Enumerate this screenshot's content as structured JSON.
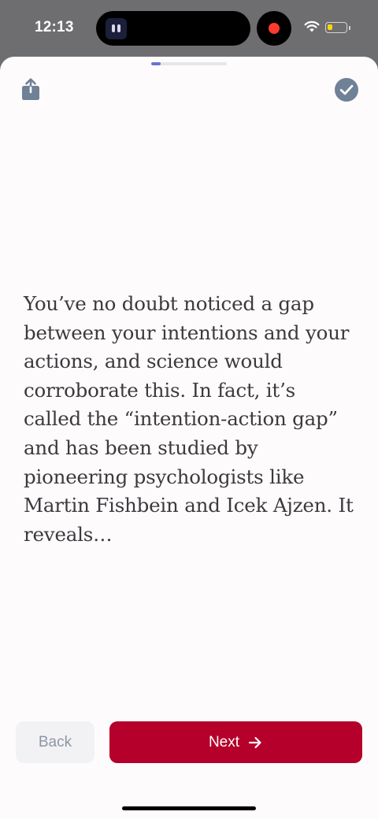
{
  "status_bar": {
    "time": "12:13",
    "battery_level": 0.3,
    "recording": true,
    "icons": {
      "wifi": "wifi-icon",
      "battery": "battery-icon",
      "record": "record-indicator-icon"
    }
  },
  "header": {
    "progress": 0.12,
    "share_icon": "share-icon",
    "done_icon": "checkmark-circle-icon"
  },
  "content": {
    "body": "You’ve no doubt noticed a gap between your intentions and your actions, and science would corroborate this. In fact, it’s called the “intention-action gap” and has been studied by pioneering psychologists like Martin Fishbein and Icek Ajzen. It reveals…"
  },
  "footer": {
    "back_label": "Back",
    "next_label": "Next",
    "next_icon": "arrow-right-icon"
  },
  "colors": {
    "accent": "#b4002b",
    "progress": "#6c72d2",
    "icon": "#6f8196",
    "sheet_bg": "#fefbfd"
  }
}
